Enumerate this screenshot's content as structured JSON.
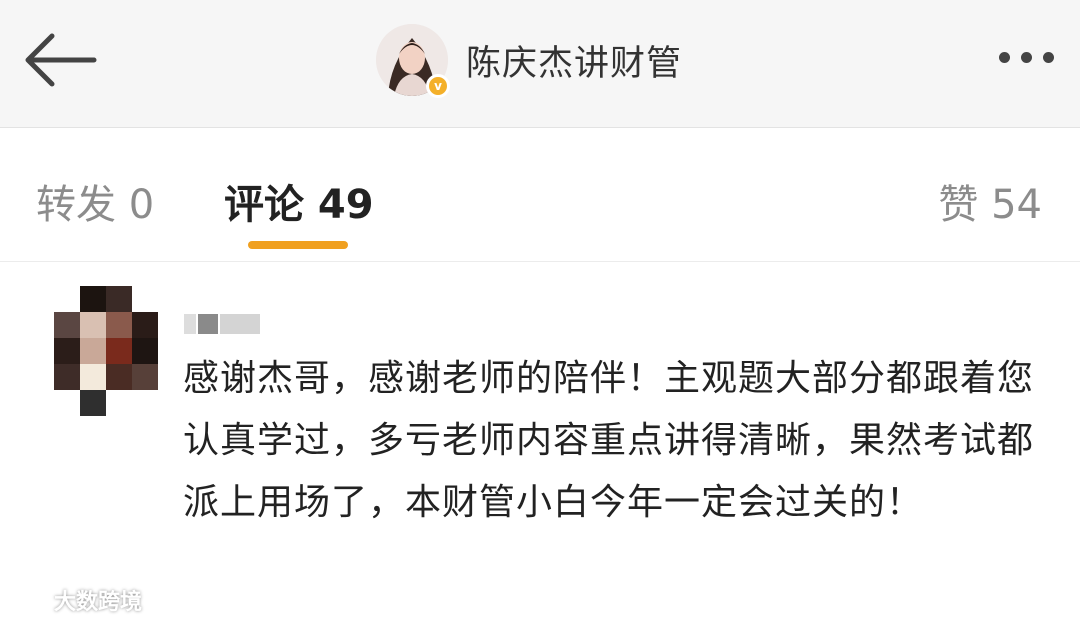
{
  "header": {
    "title": "陈庆杰讲财管",
    "back_icon": "arrow-left-icon",
    "more_icon": "more-dots-icon",
    "verified_badge": "v"
  },
  "tabs": {
    "forward_label": "转发 0",
    "comments_label": "评论 49",
    "likes_label": "赞 54",
    "active_color": "#f0a020"
  },
  "comment": {
    "text": "感谢杰哥，感谢老师的陪伴！主观题大部分都跟着您认真学过，多亏老师内容重点讲得清晰，果然考试都派上用场了，本财管小白今年一定会过关的！"
  },
  "watermark": {
    "text": "大数跨境"
  }
}
